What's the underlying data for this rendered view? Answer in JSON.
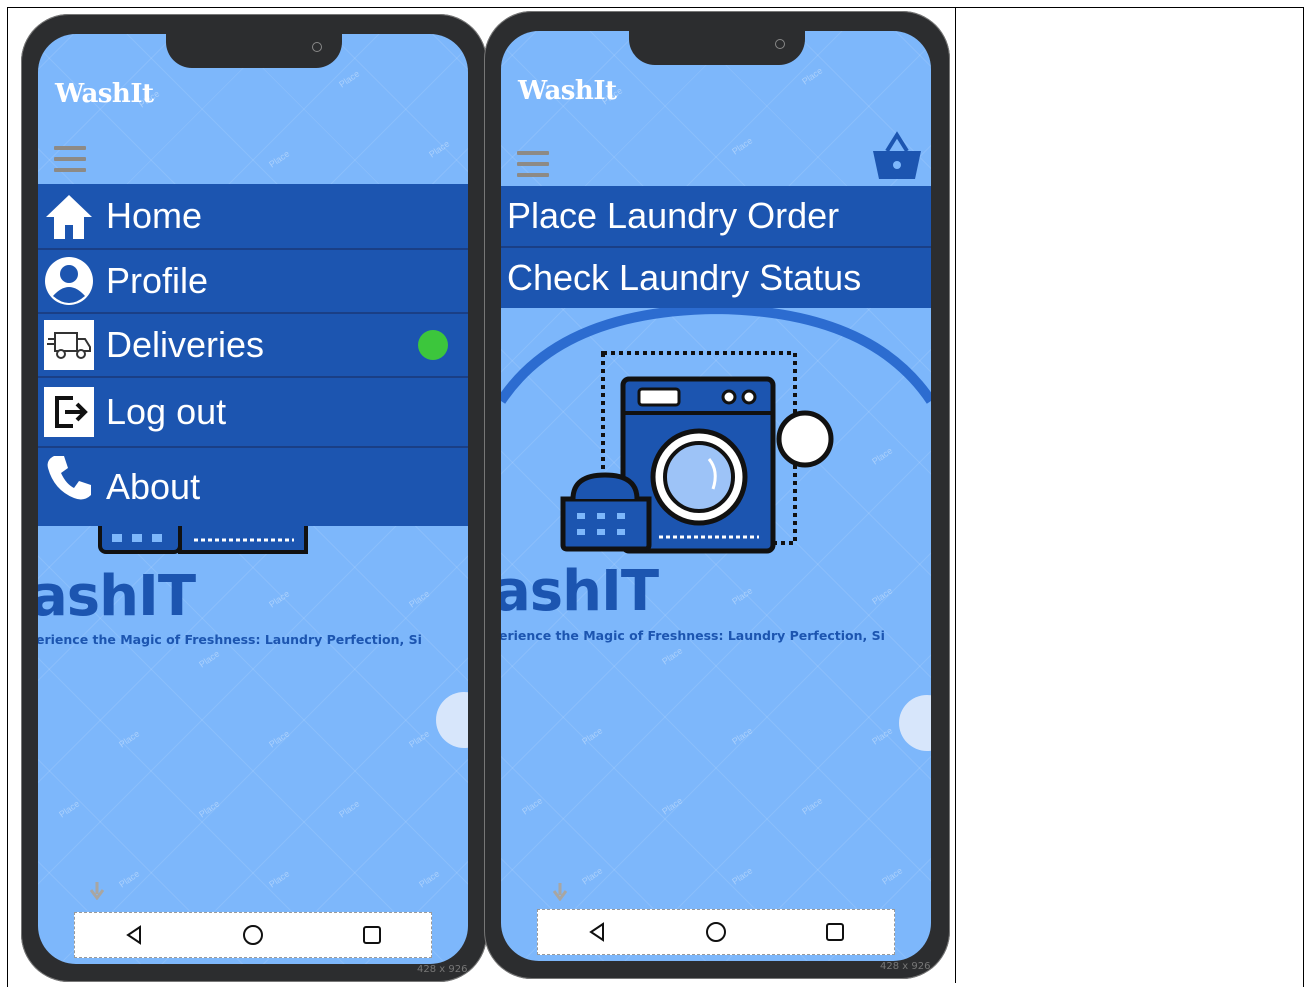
{
  "screens": [
    {
      "app_title": "WashIt",
      "menu_items": [
        {
          "label": "Home",
          "icon": "home-icon"
        },
        {
          "label": "Profile",
          "icon": "profile-icon"
        },
        {
          "label": "Deliveries",
          "icon": "delivery-truck-icon",
          "badge_color": "#3cc63c"
        },
        {
          "label": "Log out",
          "icon": "logout-icon"
        },
        {
          "label": "About",
          "icon": "phone-icon"
        }
      ],
      "brand_text": "ashIT",
      "tagline": "erience the Magic of Freshness: Laundry Perfection, Si",
      "size_label": "428 x 926"
    },
    {
      "app_title": "WashIt",
      "menu_items": [
        {
          "label": "Place Laundry Order"
        },
        {
          "label": "Check Laundry Status"
        }
      ],
      "brand_text": "ashIT",
      "tagline": "erience the Magic of Freshness: Laundry Perfection, Si",
      "size_label": "428 x 926"
    }
  ],
  "colors": {
    "screen_bg": "#7db7fb",
    "menu_bg": "#1c55b0",
    "accent_dark": "#1a3f86",
    "status_green": "#3cc63c"
  }
}
